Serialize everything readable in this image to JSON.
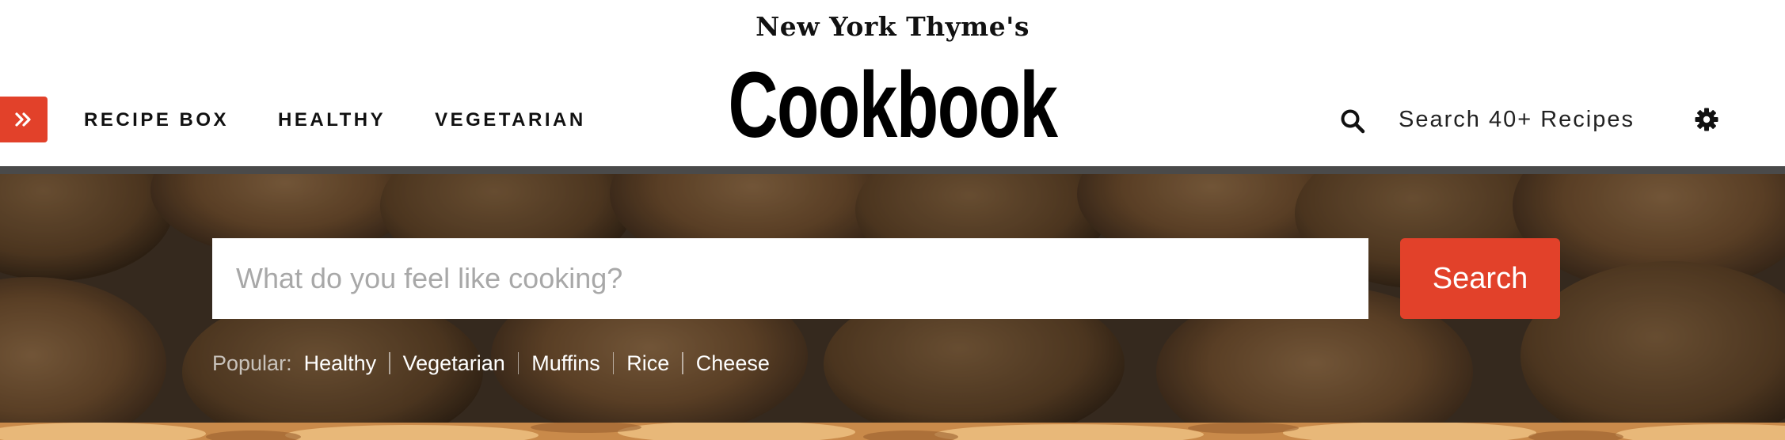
{
  "header": {
    "brand_sub": "New York Thyme's",
    "brand_main": "Cookbook",
    "nav": [
      {
        "label": "RECIPE BOX"
      },
      {
        "label": "HEALTHY"
      },
      {
        "label": "VEGETARIAN"
      }
    ],
    "search_label": "Search 40+ Recipes",
    "icons": {
      "menu": "double-chevron-right-icon",
      "search": "search-icon",
      "settings": "gear-icon"
    }
  },
  "hero": {
    "search_placeholder": "What do you feel like cooking?",
    "search_button": "Search",
    "popular_label": "Popular:",
    "popular_links": [
      "Healthy",
      "Vegetarian",
      "Muffins",
      "Rice",
      "Cheese"
    ]
  },
  "colors": {
    "accent": "#e2412a",
    "divider": "#4a4a4a",
    "text": "#111111"
  }
}
